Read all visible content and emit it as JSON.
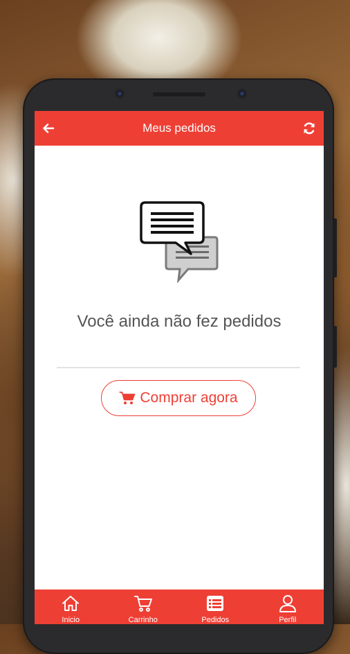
{
  "appbar": {
    "title": "Meus pedidos",
    "back_icon": "arrow-left-icon",
    "refresh_icon": "refresh-icon"
  },
  "empty_state": {
    "icon": "chat-bubbles-icon",
    "message": "Você ainda não fez pedidos"
  },
  "buy_button": {
    "icon": "shopping-cart-icon",
    "label": "Comprar agora"
  },
  "bottom_nav": {
    "items": [
      {
        "label": "Inicio",
        "icon": "home-icon"
      },
      {
        "label": "Carrinho",
        "icon": "cart-icon"
      },
      {
        "label": "Pedidos",
        "icon": "list-icon"
      },
      {
        "label": "Perfil",
        "icon": "user-icon"
      }
    ]
  },
  "colors": {
    "accent": "#ee3f35",
    "text": "#555555",
    "background": "#ffffff"
  }
}
